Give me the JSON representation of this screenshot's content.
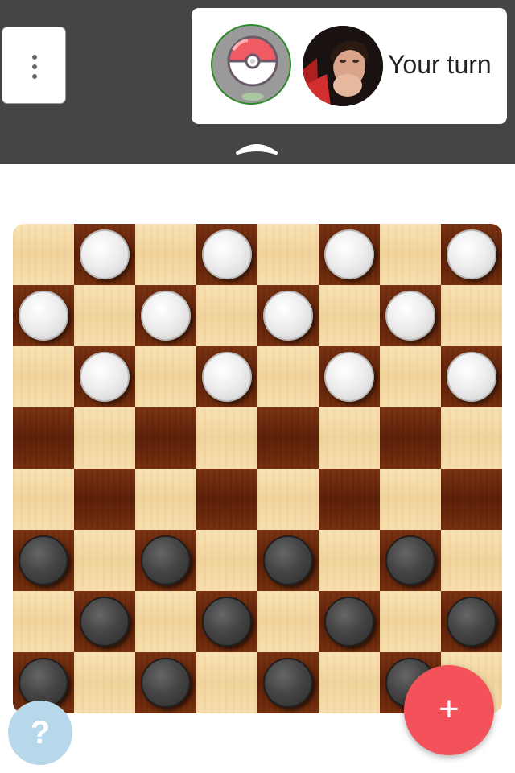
{
  "header": {
    "menu_icon": "more-vert-icon",
    "turn_status": "Your turn",
    "collapse_icon": "chevron-up-icon",
    "opponent_avatar_icon": "pokeball-icon",
    "player_avatar_icon": "user-photo",
    "active_ring_color": "#2f8a2f"
  },
  "board": {
    "size": 8,
    "light_color": "#f4dca8",
    "dark_color": "#6a280d",
    "white_pieces": [
      [
        0,
        1
      ],
      [
        0,
        3
      ],
      [
        0,
        5
      ],
      [
        0,
        7
      ],
      [
        1,
        0
      ],
      [
        1,
        2
      ],
      [
        1,
        4
      ],
      [
        1,
        6
      ],
      [
        2,
        1
      ],
      [
        2,
        3
      ],
      [
        2,
        5
      ],
      [
        2,
        7
      ]
    ],
    "black_pieces": [
      [
        5,
        0
      ],
      [
        5,
        2
      ],
      [
        5,
        4
      ],
      [
        5,
        6
      ],
      [
        6,
        1
      ],
      [
        6,
        3
      ],
      [
        6,
        5
      ],
      [
        6,
        7
      ],
      [
        7,
        0
      ],
      [
        7,
        2
      ],
      [
        7,
        4
      ],
      [
        7,
        6
      ]
    ]
  },
  "help_button": {
    "label": "?",
    "color": "#b7d8ea"
  },
  "fab": {
    "label": "+",
    "color": "#f4525a"
  }
}
